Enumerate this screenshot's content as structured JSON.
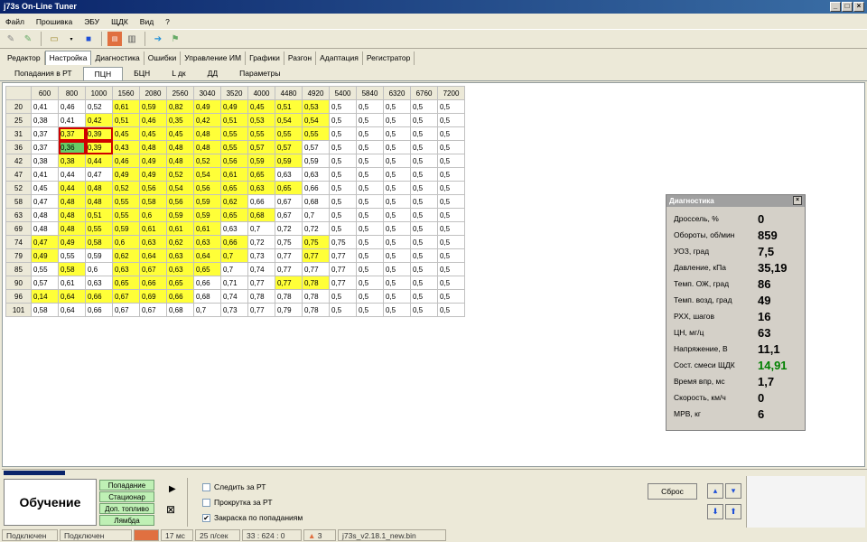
{
  "window": {
    "title": "j73s On-Line Tuner",
    "min": "_",
    "max": "□",
    "close": "×"
  },
  "menu": [
    "Файл",
    "Прошивка",
    "ЭБУ",
    "ЩДК",
    "Вид",
    "?"
  ],
  "tabs_main": [
    "Редактор",
    "Настройка",
    "Диагностика",
    "Ошибки",
    "Управление ИМ",
    "Графики",
    "Разгон",
    "Адаптация",
    "Регистратор"
  ],
  "tabs_sub": [
    "Попадания в РТ",
    "ПЦН",
    "БЦН",
    "L дк",
    "ДД",
    "Параметры"
  ],
  "grid": {
    "cols": [
      "600",
      "800",
      "1000",
      "1560",
      "2080",
      "2560",
      "3040",
      "3520",
      "4000",
      "4480",
      "4920",
      "5400",
      "5840",
      "6320",
      "6760",
      "7200"
    ],
    "rows": [
      {
        "h": "20",
        "c": [
          "0,41",
          "0,46",
          "0,52",
          "0,61",
          "0,59",
          "0,82",
          "0,49",
          "0,49",
          "0,45",
          "0,51",
          "0,53",
          "0,5",
          "0,5",
          "0,5",
          "0,5",
          "0,5"
        ],
        "hl": "nnnyyyyyyyynnnnn"
      },
      {
        "h": "25",
        "c": [
          "0,38",
          "0,41",
          "0,42",
          "0,51",
          "0,46",
          "0,35",
          "0,42",
          "0,51",
          "0,53",
          "0,54",
          "0,54",
          "0,5",
          "0,5",
          "0,5",
          "0,5",
          "0,5"
        ],
        "hl": "nnyyyyyyyyynnnnn"
      },
      {
        "h": "31",
        "c": [
          "0,37",
          "0,37",
          "0,39",
          "0,45",
          "0,45",
          "0,45",
          "0,48",
          "0,55",
          "0,55",
          "0,55",
          "0,55",
          "0,5",
          "0,5",
          "0,5",
          "0,5",
          "0,5"
        ],
        "hl": "nyyyyyyyyyynnnnn"
      },
      {
        "h": "36",
        "c": [
          "0,37",
          "0,36",
          "0,39",
          "0,43",
          "0,48",
          "0,48",
          "0,48",
          "0,55",
          "0,57",
          "0,57",
          "0,57",
          "0,5",
          "0,5",
          "0,5",
          "0,5",
          "0,5"
        ],
        "hl": "ngyyyyyyyynnnnnn"
      },
      {
        "h": "42",
        "c": [
          "0,38",
          "0,38",
          "0,44",
          "0,46",
          "0,49",
          "0,48",
          "0,52",
          "0,56",
          "0,59",
          "0,59",
          "0,59",
          "0,5",
          "0,5",
          "0,5",
          "0,5",
          "0,5"
        ],
        "hl": "nyyyyyyyyynnnnnn"
      },
      {
        "h": "47",
        "c": [
          "0,41",
          "0,44",
          "0,47",
          "0,49",
          "0,49",
          "0,52",
          "0,54",
          "0,61",
          "0,65",
          "0,63",
          "0,63",
          "0,5",
          "0,5",
          "0,5",
          "0,5",
          "0,5"
        ],
        "hl": "nnnyyyyyynnnnnnn"
      },
      {
        "h": "52",
        "c": [
          "0,45",
          "0,44",
          "0,48",
          "0,52",
          "0,56",
          "0,54",
          "0,56",
          "0,65",
          "0,63",
          "0,65",
          "0,66",
          "0,5",
          "0,5",
          "0,5",
          "0,5",
          "0,5"
        ],
        "hl": "nyyyyyyyyynnnnnn"
      },
      {
        "h": "58",
        "c": [
          "0,47",
          "0,48",
          "0,48",
          "0,55",
          "0,58",
          "0,56",
          "0,59",
          "0,62",
          "0,66",
          "0,67",
          "0,68",
          "0,5",
          "0,5",
          "0,5",
          "0,5",
          "0,5"
        ],
        "hl": "nyyyyyyynnnnnnnn"
      },
      {
        "h": "63",
        "c": [
          "0,48",
          "0,48",
          "0,51",
          "0,55",
          "0,6",
          "0,59",
          "0,59",
          "0,65",
          "0,68",
          "0,67",
          "0,7",
          "0,5",
          "0,5",
          "0,5",
          "0,5",
          "0,5"
        ],
        "hl": "nyyyyyyyynnnnnnn"
      },
      {
        "h": "69",
        "c": [
          "0,48",
          "0,48",
          "0,55",
          "0,59",
          "0,61",
          "0,61",
          "0,61",
          "0,63",
          "0,7",
          "0,72",
          "0,72",
          "0,5",
          "0,5",
          "0,5",
          "0,5",
          "0,5"
        ],
        "hl": "nyyyyyynnnnnnnnn"
      },
      {
        "h": "74",
        "c": [
          "0,47",
          "0,49",
          "0,58",
          "0,6",
          "0,63",
          "0,62",
          "0,63",
          "0,66",
          "0,72",
          "0,75",
          "0,75",
          "0,75",
          "0,5",
          "0,5",
          "0,5",
          "0,5"
        ],
        "hl": "yyyyyyyynnynnnnn"
      },
      {
        "h": "79",
        "c": [
          "0,49",
          "0,55",
          "0,59",
          "0,62",
          "0,64",
          "0,63",
          "0,64",
          "0,7",
          "0,73",
          "0,77",
          "0,77",
          "0,77",
          "0,5",
          "0,5",
          "0,5",
          "0,5"
        ],
        "hl": "ynnyyyyynnynnnnn"
      },
      {
        "h": "85",
        "c": [
          "0,55",
          "0,58",
          "0,6",
          "0,63",
          "0,67",
          "0,63",
          "0,65",
          "0,7",
          "0,74",
          "0,77",
          "0,77",
          "0,77",
          "0,5",
          "0,5",
          "0,5",
          "0,5"
        ],
        "hl": "nynyyyynnnnnnnnn"
      },
      {
        "h": "90",
        "c": [
          "0,57",
          "0,61",
          "0,63",
          "0,65",
          "0,66",
          "0,65",
          "0,66",
          "0,71",
          "0,77",
          "0,77",
          "0,78",
          "0,77",
          "0,5",
          "0,5",
          "0,5",
          "0,5"
        ],
        "hl": "nnnyyynnnyynnnnn"
      },
      {
        "h": "96",
        "c": [
          "0,14",
          "0,64",
          "0,66",
          "0,67",
          "0,69",
          "0,66",
          "0,68",
          "0,74",
          "0,78",
          "0,78",
          "0,78",
          "0,5",
          "0,5",
          "0,5",
          "0,5",
          "0,5"
        ],
        "hl": "yyyyyynnnnnnnnnn"
      },
      {
        "h": "101",
        "c": [
          "0,58",
          "0,64",
          "0,66",
          "0,67",
          "0,67",
          "0,68",
          "0,7",
          "0,73",
          "0,77",
          "0,79",
          "0,78",
          "0,5",
          "0,5",
          "0,5",
          "0,5",
          "0,5"
        ],
        "hl": "nnnnnnnnnnnnnnnn"
      }
    ]
  },
  "diag": {
    "title": "Диагностика",
    "close": "×",
    "items": [
      {
        "label": "Дроссель, %",
        "value": "0"
      },
      {
        "label": "Обороты, об/мин",
        "value": "859"
      },
      {
        "label": "УОЗ, град",
        "value": "7,5"
      },
      {
        "label": "Давление, кПа",
        "value": "35,19"
      },
      {
        "label": "Темп. ОЖ, град",
        "value": "86"
      },
      {
        "label": "Темп. возд, град",
        "value": "49"
      },
      {
        "label": "РХХ, шагов",
        "value": "16"
      },
      {
        "label": "ЦН, мг/ц",
        "value": "63"
      },
      {
        "label": "Напряжение, В",
        "value": "11,1"
      },
      {
        "label": "Сост. смеси ЩДК",
        "value": "14,91",
        "color": "#008000"
      },
      {
        "label": "Время впр, мс",
        "value": "1,7"
      },
      {
        "label": "Скорость, км/ч",
        "value": "0"
      },
      {
        "label": "МРВ, кг",
        "value": "6"
      }
    ]
  },
  "bottom": {
    "mode": "Обучение",
    "green_buttons": [
      "Попадание",
      "Стационар",
      "Доп. топливо",
      "Лямбда"
    ],
    "checkboxes": [
      {
        "label": "Следить за РТ",
        "checked": false
      },
      {
        "label": "Прокрутка за РТ",
        "checked": false
      },
      {
        "label": "Закраска по попаданиям",
        "checked": true
      }
    ],
    "reset": "Сброс",
    "play": "▶",
    "stop": "⊠",
    "check": "✔"
  },
  "status": [
    "Подключен",
    "Подключен",
    "17 мс",
    "25 п/сек",
    "33 : 624 : 0",
    "3",
    "j73s_v2.18.1_new.bin"
  ]
}
